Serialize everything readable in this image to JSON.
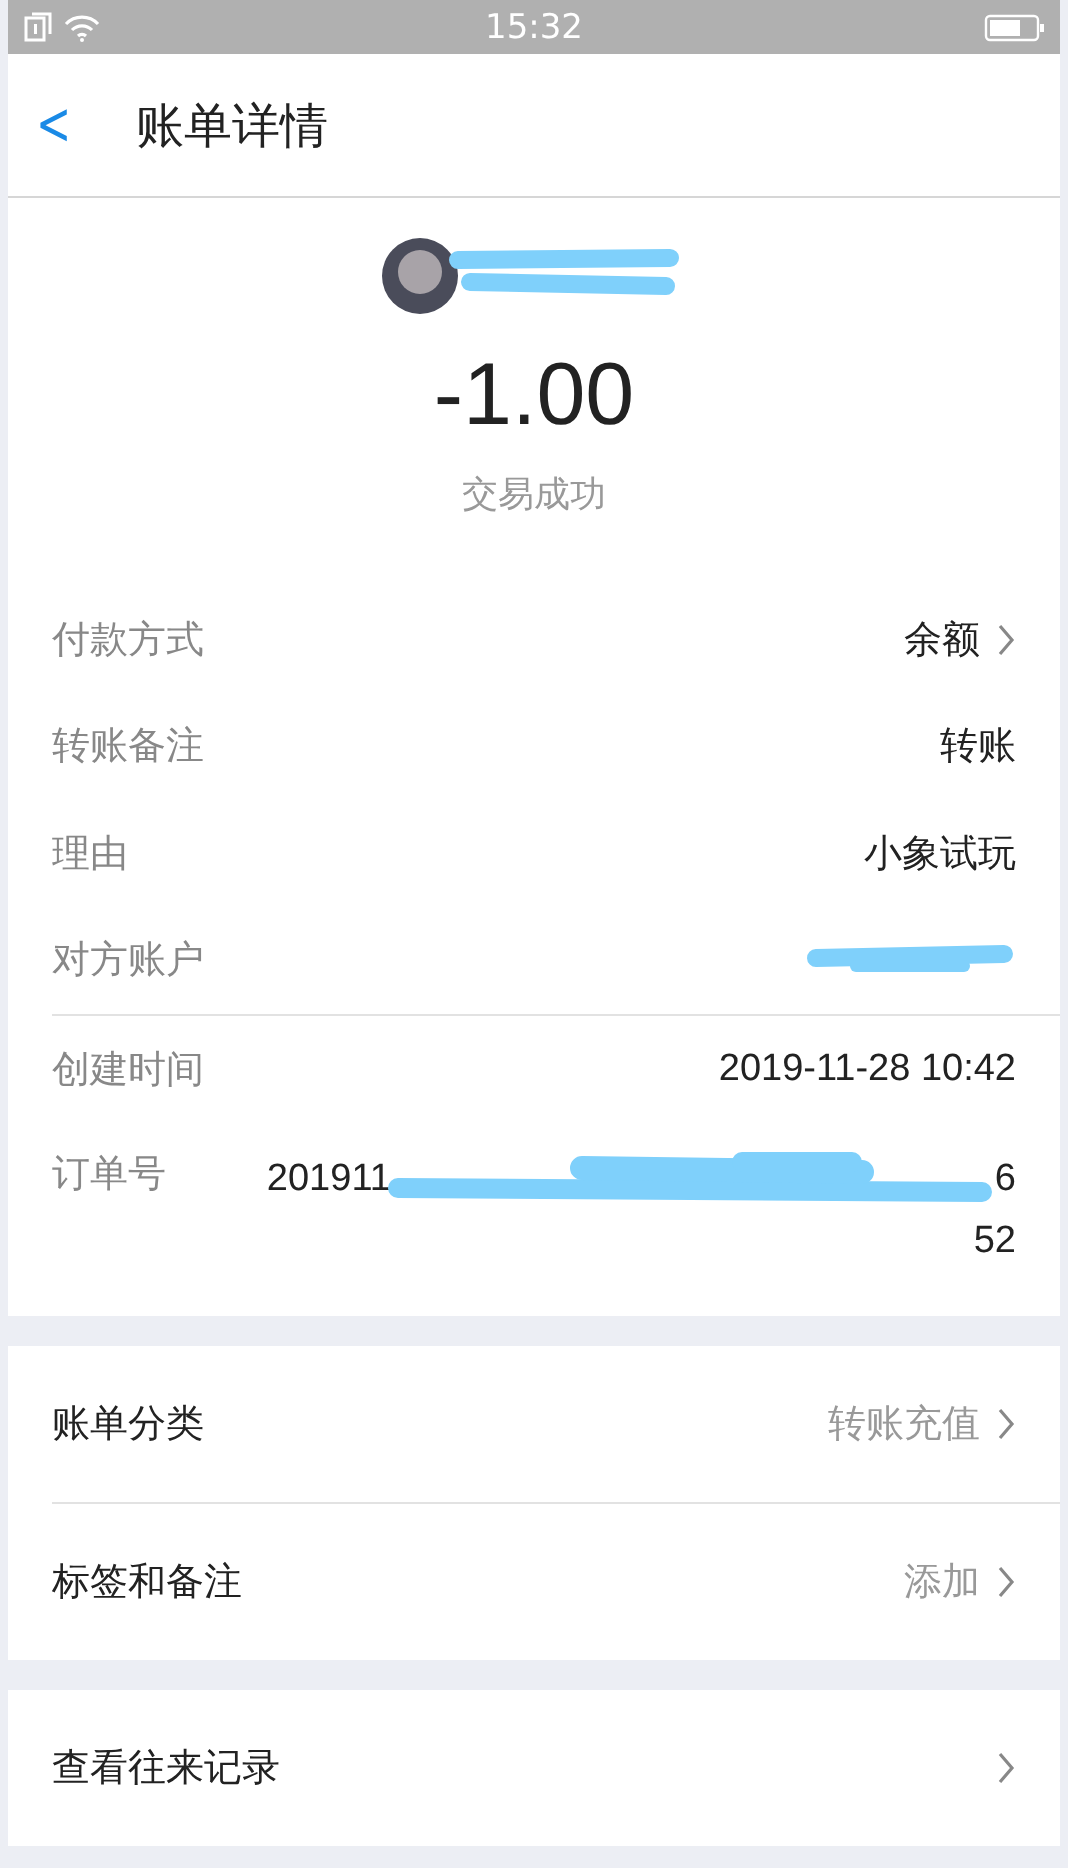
{
  "status_bar": {
    "time": "15:32"
  },
  "header": {
    "back": "<",
    "title": "账单详情"
  },
  "summary": {
    "amount": "-1.00",
    "status": "交易成功"
  },
  "detail_rows": [
    {
      "kind": "link",
      "label": "付款方式",
      "value": "余额"
    },
    {
      "kind": "text",
      "label": "转账备注",
      "value": "转账"
    },
    {
      "kind": "text",
      "label": "理由",
      "value": "小象试玩"
    },
    {
      "kind": "redacted",
      "label": "对方账户"
    }
  ],
  "time_row": {
    "label": "创建时间",
    "value": "2019-11-28 10:42"
  },
  "order_row": {
    "label": "订单号",
    "start": "201911",
    "end": "6",
    "second_line": "52"
  },
  "category_rows": [
    {
      "label": "账单分类",
      "value": "转账充值"
    },
    {
      "label": "标签和备注",
      "value": "添加"
    }
  ],
  "history_row": {
    "label": "查看往来记录"
  }
}
